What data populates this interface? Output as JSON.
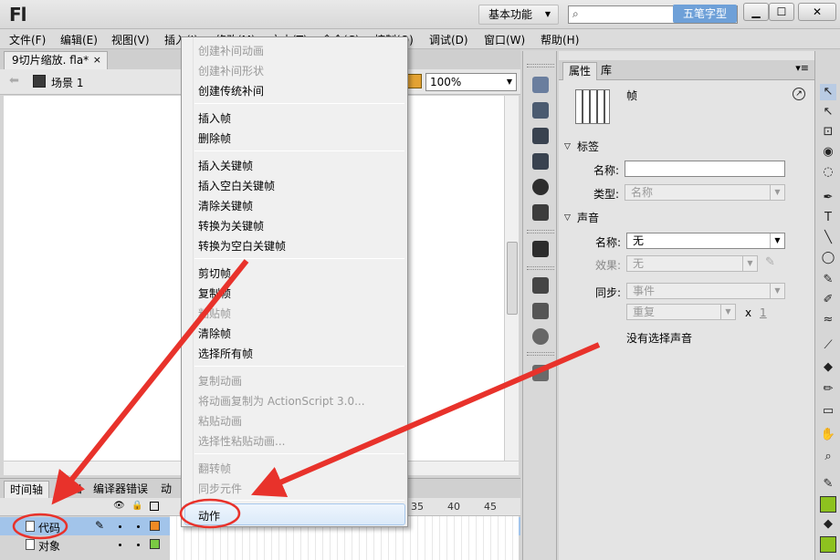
{
  "window": {
    "app_logo": "Fl",
    "workspace": "基本功能",
    "search_placeholder": "",
    "watermark": "五笔字型",
    "min_glyph": "▁",
    "max_glyph": "☐",
    "close_glyph": "✕"
  },
  "menubar": {
    "items": [
      {
        "label": "文件(F)"
      },
      {
        "label": "编辑(E)"
      },
      {
        "label": "视图(V)"
      },
      {
        "label": "插入(I)"
      },
      {
        "label": "修改(M)"
      },
      {
        "label": "文本(T)"
      },
      {
        "label": "命令(C)"
      },
      {
        "label": "控制(O)"
      },
      {
        "label": "调试(D)"
      },
      {
        "label": "窗口(W)"
      },
      {
        "label": "帮助(H)"
      }
    ]
  },
  "document": {
    "tab_label": "9切片缩放. fla*",
    "tab_close": "×",
    "scene": "场景 1",
    "zoom": "100%"
  },
  "timeline": {
    "tabs": [
      "时间轴",
      "输出",
      "编译器错误",
      "动"
    ],
    "ruler": [
      "35",
      "40",
      "45"
    ],
    "layers": [
      {
        "name": "代码",
        "selected": true,
        "color": "#f08a24"
      },
      {
        "name": "对象",
        "selected": false,
        "color": "#7ac943"
      }
    ]
  },
  "context_menu": {
    "items": [
      {
        "label": "创建补间动画",
        "enabled": false
      },
      {
        "label": "创建补间形状",
        "enabled": false
      },
      {
        "label": "创建传统补间",
        "enabled": true
      },
      {
        "label": "插入帧",
        "enabled": true
      },
      {
        "label": "删除帧",
        "enabled": true
      },
      {
        "label": "插入关键帧",
        "enabled": true
      },
      {
        "label": "插入空白关键帧",
        "enabled": true
      },
      {
        "label": "清除关键帧",
        "enabled": true
      },
      {
        "label": "转换为关键帧",
        "enabled": true
      },
      {
        "label": "转换为空白关键帧",
        "enabled": true
      },
      {
        "label": "剪切帧",
        "enabled": true
      },
      {
        "label": "复制帧",
        "enabled": true
      },
      {
        "label": "粘贴帧",
        "enabled": false
      },
      {
        "label": "清除帧",
        "enabled": true
      },
      {
        "label": "选择所有帧",
        "enabled": true
      },
      {
        "label": "复制动画",
        "enabled": false
      },
      {
        "label": "将动画复制为 ActionScript 3.0...",
        "enabled": false
      },
      {
        "label": "粘贴动画",
        "enabled": false
      },
      {
        "label": "选择性粘贴动画...",
        "enabled": false
      },
      {
        "label": "翻转帧",
        "enabled": false
      },
      {
        "label": "同步元件",
        "enabled": false
      },
      {
        "label": "动作",
        "enabled": true,
        "highlighted": true
      }
    ]
  },
  "properties": {
    "tabs": [
      "属性",
      "库"
    ],
    "frame_title": "帧",
    "label_section": "标签",
    "name_label": "名称:",
    "name_value": "",
    "type_label": "类型:",
    "type_value": "名称",
    "sound_section": "声音",
    "sound_name_label": "名称:",
    "sound_name_value": "无",
    "effect_label": "效果:",
    "effect_value": "无",
    "sync_label": "同步:",
    "sync_value": "事件",
    "repeat_value": "重复",
    "repeat_x": "x",
    "repeat_count": "1",
    "no_sound_text": "没有选择声音"
  },
  "tools_right": {
    "glyphs": [
      "▲",
      "↖",
      "⊡",
      "◉",
      "◌",
      "✒",
      "T",
      "╲",
      "◯",
      "✎",
      "✐",
      "≈",
      "⟋",
      "◆",
      "✏",
      "▭",
      "✋",
      "⌕"
    ]
  },
  "colors": {
    "annotation_red": "#e8322b",
    "selected_layer": "#a2c4ea",
    "fill_green": "#8dc21f"
  }
}
